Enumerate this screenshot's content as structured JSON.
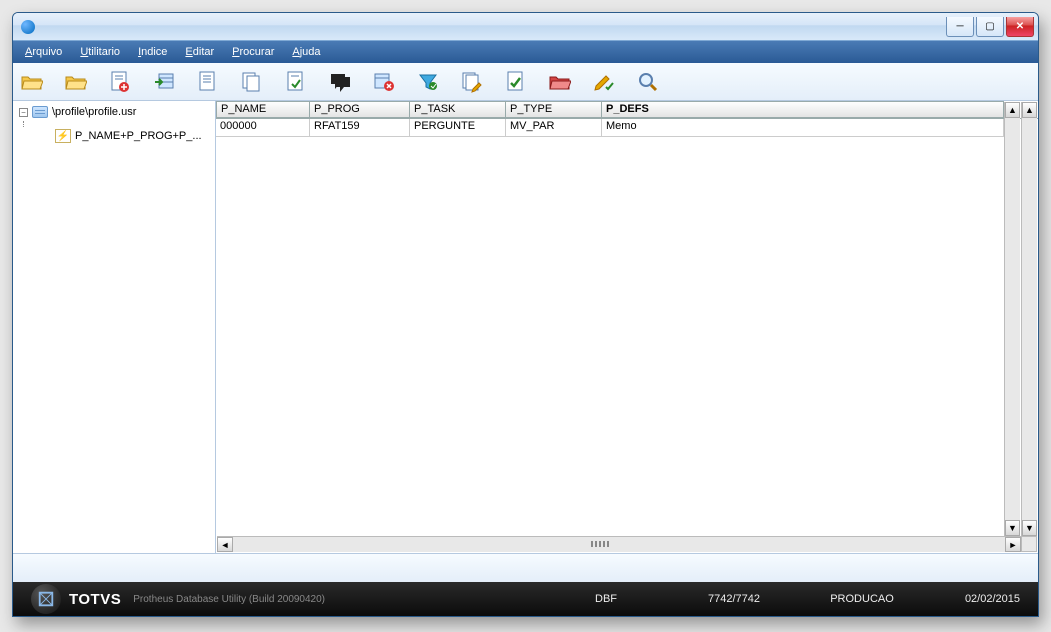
{
  "title": "",
  "menu": {
    "m0": "Arquivo",
    "m1": "Utilitario",
    "m2": "Indice",
    "m3": "Editar",
    "m4": "Procurar",
    "m5": "Ajuda"
  },
  "tree": {
    "root": "\\profile\\profile.usr",
    "child": "P_NAME+P_PROG+P_..."
  },
  "grid": {
    "headers": {
      "h0": "P_NAME",
      "h1": "P_PROG",
      "h2": "P_TASK",
      "h3": "P_TYPE",
      "h4": "P_DEFS"
    },
    "row": {
      "c0": "000000",
      "c1": "RFAT159",
      "c2": "PERGUNTE",
      "c3": "MV_PAR",
      "c4": "Memo"
    }
  },
  "status": {
    "brand": "TOTVS",
    "subtitle": "Protheus Database Utility (Build 20090420)",
    "f0": "DBF",
    "f1": "7742/7742",
    "f2": "PRODUCAO",
    "f3": "02/02/2015"
  }
}
